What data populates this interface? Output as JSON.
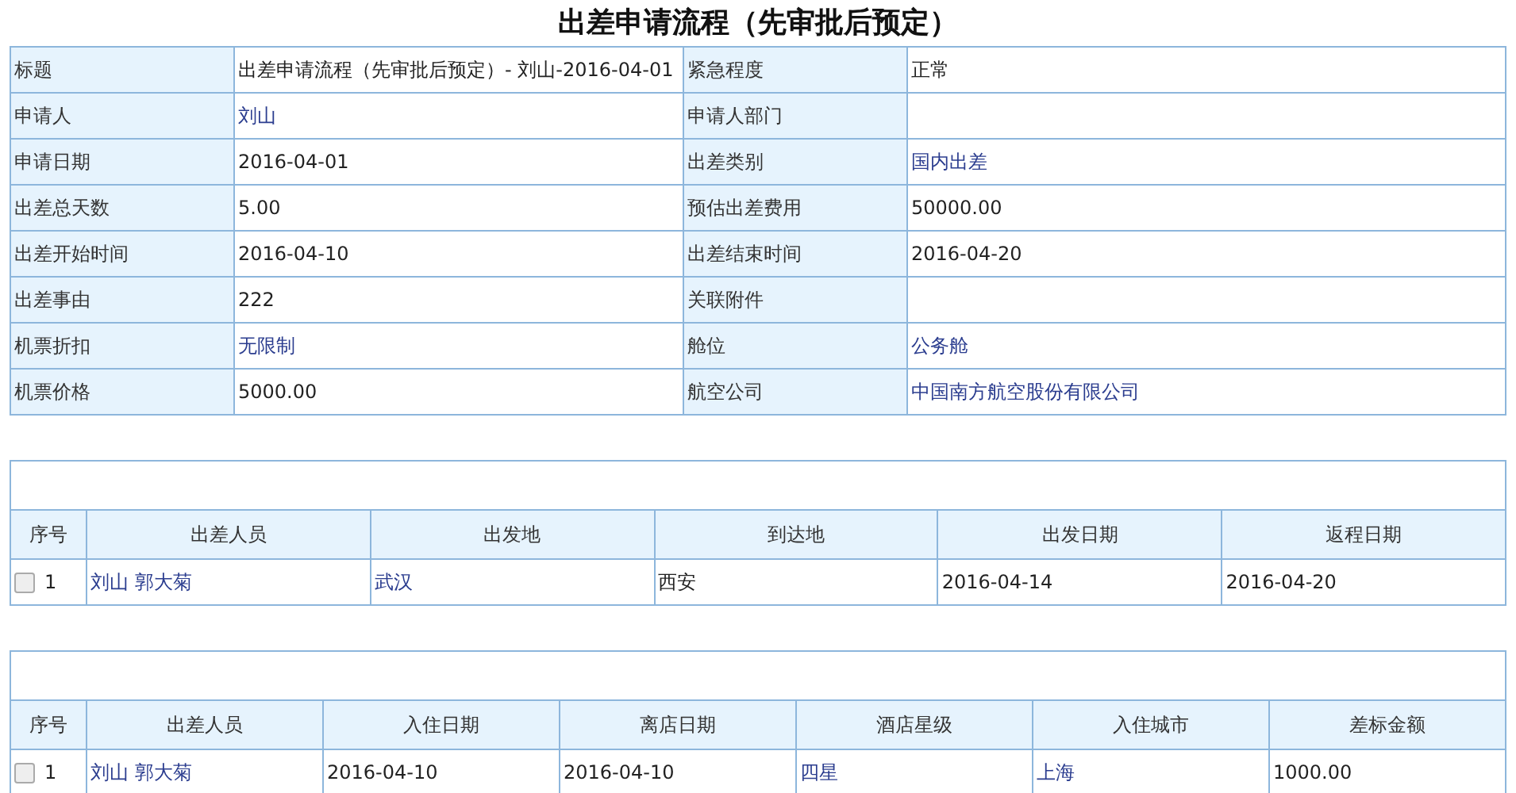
{
  "title": "出差申请流程（先审批后预定）",
  "fields": [
    {
      "label": "标题",
      "value": "出差申请流程（先审批后预定）- 刘山-2016-04-01",
      "kind": "text"
    },
    {
      "label": "紧急程度",
      "value": "正常",
      "kind": "text"
    },
    {
      "label": "申请人",
      "value": "刘山",
      "kind": "option"
    },
    {
      "label": "申请人部门",
      "kind": "text"
    },
    {
      "label": "申请日期",
      "value": "2016-04-01",
      "kind": "text"
    },
    {
      "label": "出差类别",
      "value": "国内出差",
      "kind": "option"
    },
    {
      "label": "出差总天数",
      "value": "5.00",
      "kind": "text"
    },
    {
      "label": "预估出差费用",
      "value": "50000.00",
      "kind": "text"
    },
    {
      "label": "出差开始时间",
      "value": "2016-04-10",
      "kind": "text"
    },
    {
      "label": "出差结束时间",
      "value": "2016-04-20",
      "kind": "text"
    },
    {
      "label": "出差事由",
      "value": "222",
      "kind": "text"
    },
    {
      "label": "关联附件",
      "kind": "text"
    },
    {
      "label": "机票折扣",
      "value": "无限制",
      "kind": "option"
    },
    {
      "label": "舱位",
      "value": "公务舱",
      "kind": "option"
    },
    {
      "label": "机票价格",
      "value": "5000.00",
      "kind": "text"
    },
    {
      "label": "航空公司",
      "value": "中国南方航空股份有限公司",
      "kind": "option"
    }
  ],
  "tables": [
    {
      "columns": [
        "序号",
        "出差人员",
        "出发地",
        "到达地",
        "出发日期",
        "返程日期"
      ],
      "rows": [
        {
          "cells": [
            {
              "kind": "index",
              "text": "1",
              "checked": false
            },
            {
              "text": "刘山 郭大菊",
              "kind": "option"
            },
            {
              "text": "武汉",
              "kind": "option"
            },
            {
              "text": "西安",
              "kind": "text"
            },
            {
              "text": "2016-04-14",
              "kind": "text"
            },
            {
              "text": "2016-04-20",
              "kind": "text"
            }
          ]
        }
      ]
    },
    {
      "columns": [
        "序号",
        "出差人员",
        "入住日期",
        "离店日期",
        "酒店星级",
        "入住城市",
        "差标金额"
      ],
      "rows": [
        {
          "cells": [
            {
              "kind": "index",
              "text": "1",
              "checked": false
            },
            {
              "text": "刘山 郭大菊",
              "kind": "option"
            },
            {
              "text": "2016-04-10",
              "kind": "text"
            },
            {
              "text": "2016-04-10",
              "kind": "text"
            },
            {
              "text": "四星",
              "kind": "option"
            },
            {
              "text": "上海",
              "kind": "option"
            },
            {
              "text": "1000.00",
              "kind": "text"
            }
          ]
        }
      ]
    }
  ]
}
